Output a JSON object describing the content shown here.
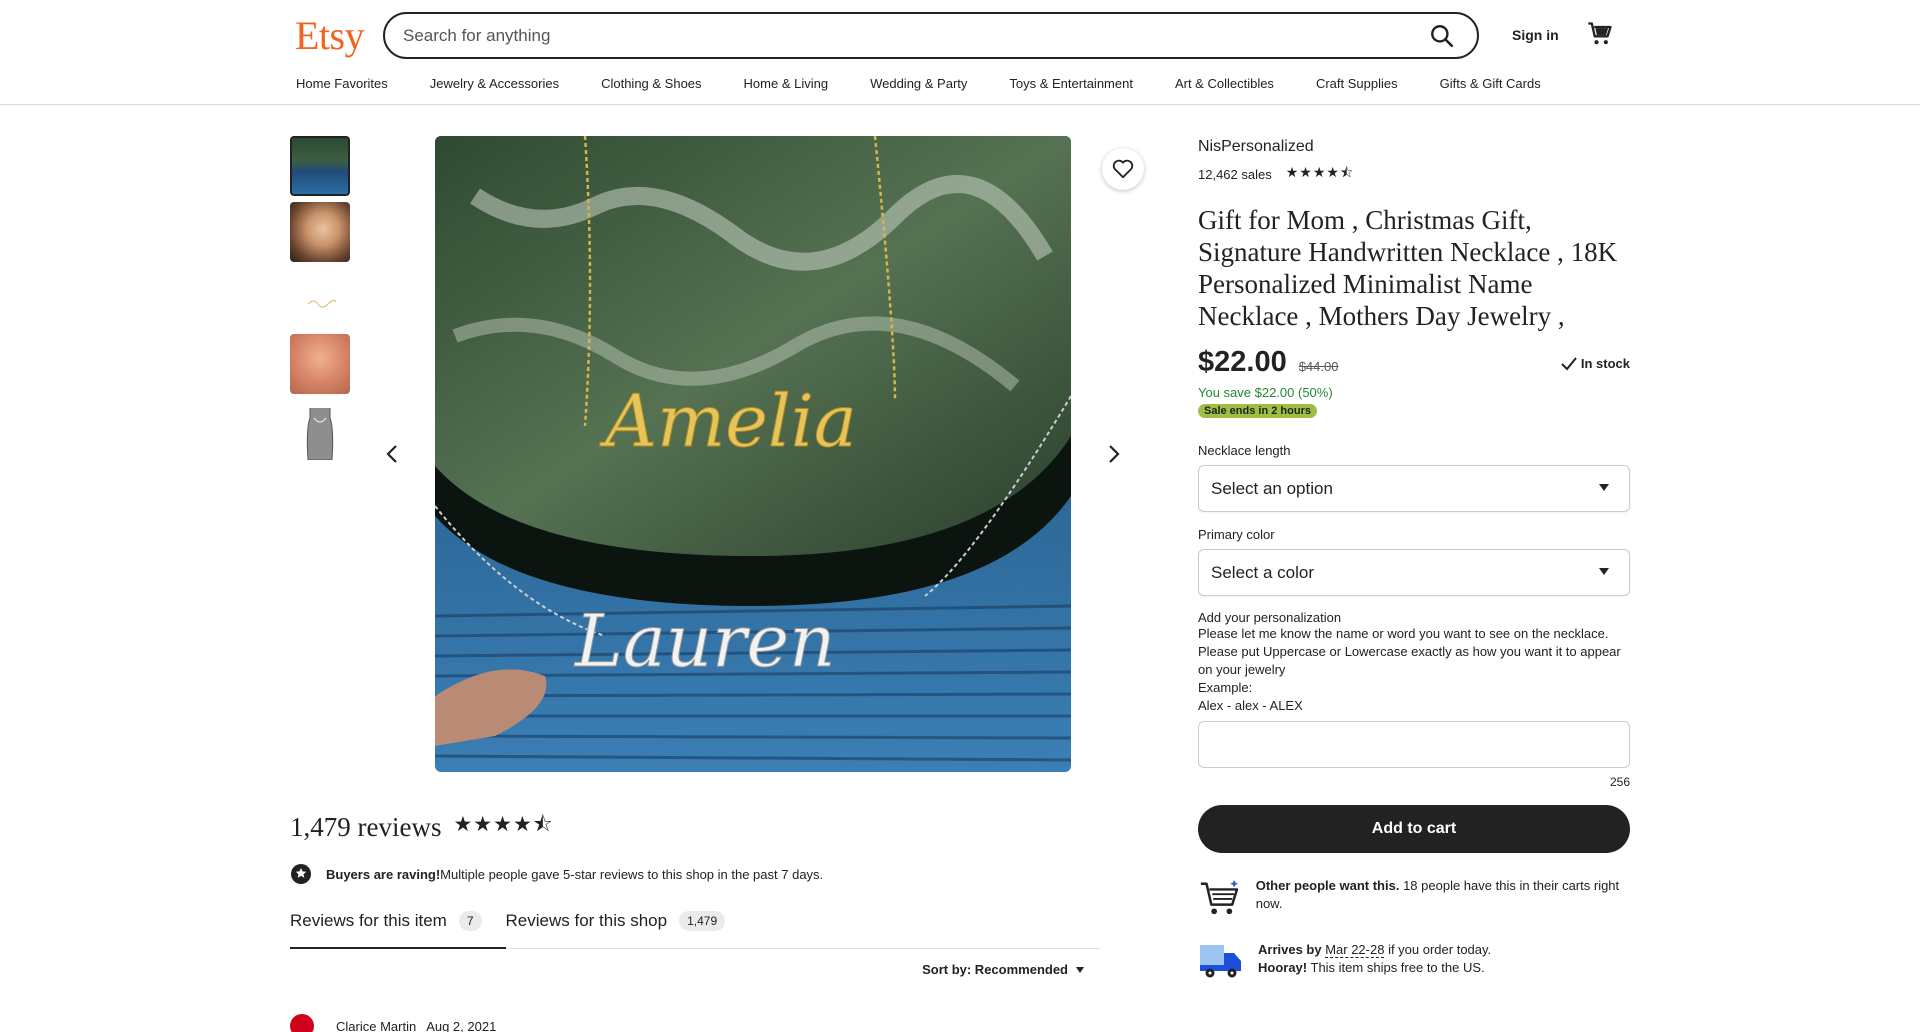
{
  "header": {
    "logo": "Etsy",
    "search_placeholder": "Search for anything",
    "sign_in": "Sign in"
  },
  "categories": [
    "Home Favorites",
    "Jewelry & Accessories",
    "Clothing & Shoes",
    "Home & Living",
    "Wedding & Party",
    "Toys & Entertainment",
    "Art & Collectibles",
    "Craft Supplies",
    "Gifts & Gift Cards"
  ],
  "product": {
    "shop_name": "NisPersonalized",
    "sales": "12,462 sales",
    "shop_rating_stars": 4.5,
    "title": "Gift for Mom , Christmas Gift, Signature Handwritten Necklace , 18K Personalized Minimalist Name Necklace , Mothers Day Jewelry ,",
    "price": "$22.00",
    "original_price": "$44.00",
    "stock": "In stock",
    "savings": "You save $22.00 (50%)",
    "sale_badge": "Sale ends in 2 hours",
    "necklace_length_label": "Necklace length",
    "necklace_length_value": "Select an option",
    "color_label": "Primary color",
    "color_value": "Select a color",
    "personalization_label": "Add your personalization",
    "personalization_instructions": [
      "Please let me know the name or word you want to see on the necklace.",
      "Please put Uppercase or Lowercase exactly as how you want it to appear on your jewelry",
      "Example:",
      "Alex - alex - ALEX"
    ],
    "char_count": "256",
    "add_to_cart": "Add to cart",
    "demand_bold": "Other people want this.",
    "demand_rest": " 18 people have this in their carts right now.",
    "arrives_prefix": "Arrives by ",
    "arrives_date": "Mar 22-28",
    "arrives_suffix": " if you order today.",
    "hooray_bold": "Hooray!",
    "hooray_rest": " This item ships free to the US.",
    "image_names": [
      "Amelia",
      "Lauren"
    ]
  },
  "reviews": {
    "count_label": "1,479 reviews",
    "rating_stars": 4.5,
    "raving_bold": "Buyers are raving!",
    "raving_rest": " Multiple people gave 5-star reviews to this shop in the past 7 days.",
    "tab_item": "Reviews for this item",
    "tab_item_count": "7",
    "tab_shop": "Reviews for this shop",
    "tab_shop_count": "1,479",
    "sort": "Sort by: Recommended",
    "first_reviewer": "Clarice Martin",
    "first_date": "Aug 2, 2021"
  },
  "colors": {
    "brand": "#F1641E",
    "save_green": "#258635",
    "sale_badge": "#9EBF43"
  },
  "icons": [
    "search-icon",
    "cart-icon",
    "heart-icon",
    "chevron-left-icon",
    "chevron-right-icon",
    "check-icon",
    "star-icon",
    "cart-demand-icon",
    "truck-icon",
    "raving-icon",
    "caret-down-icon"
  ]
}
